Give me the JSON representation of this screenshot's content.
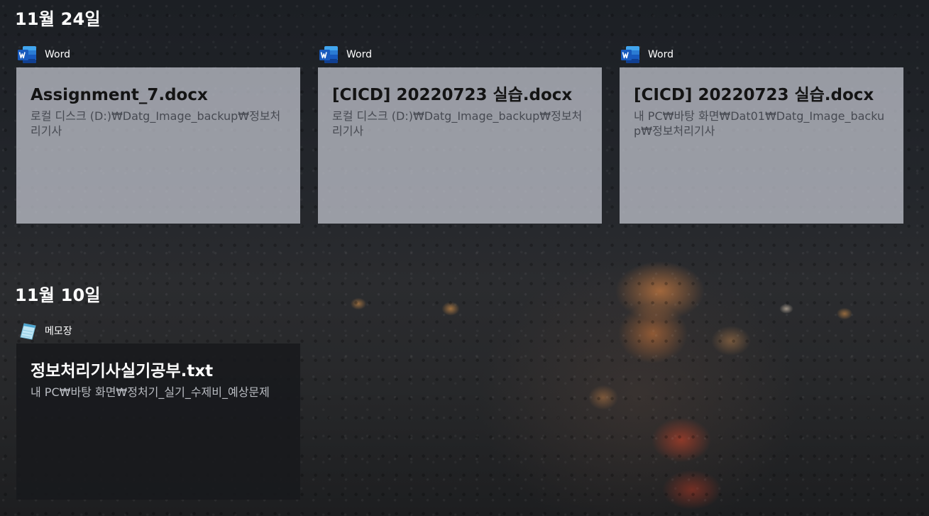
{
  "icons": {
    "word": "word-icon",
    "notepad": "notepad-icon"
  },
  "colors": {
    "word_blue": "#185abd",
    "card_light": "#c8cbd4",
    "card_dark": "#18191c"
  },
  "groups": [
    {
      "date": "11월 24일",
      "cards": [
        {
          "app": "Word",
          "title": "Assignment_7.docx",
          "path": "로컬 디스크 (D:)₩Datg_Image_backup₩정보처리기사"
        },
        {
          "app": "Word",
          "title": "[CICD] 20220723 실습.docx",
          "path": "로컬 디스크 (D:)₩Datg_Image_backup₩정보처리기사"
        },
        {
          "app": "Word",
          "title": "[CICD] 20220723 실습.docx",
          "path": "내 PC₩바탕 화면₩Dat01₩Datg_Image_backup₩정보처리기사"
        }
      ]
    },
    {
      "date": "11월 10일",
      "cards": [
        {
          "app": "메모장",
          "title": "정보처리기사실기공부.txt",
          "path": "내 PC₩바탕 화면₩정처기_실기_수제비_예상문제"
        }
      ]
    }
  ]
}
